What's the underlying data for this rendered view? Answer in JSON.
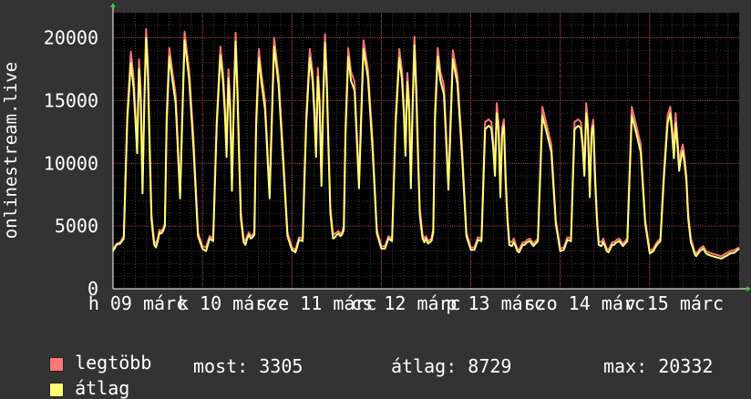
{
  "chart_data": {
    "type": "line",
    "ylabel": "onlinestream.live",
    "ylim": [
      0,
      22000
    ],
    "yticks": [
      "0",
      "5000",
      "10000",
      "15000",
      "20000"
    ],
    "xlim": [
      0,
      7
    ],
    "xtick_labels": [
      "h 09 márc",
      "k 10 márc",
      "sze 11 márc",
      "cs 12 márc",
      "p 13 márc",
      "szo 14 márc",
      "v 15 márc"
    ],
    "xticks": [
      0,
      1,
      2,
      3,
      4,
      5,
      6
    ],
    "grid": true,
    "background": "#000000",
    "series": [
      {
        "name": "legtöbb",
        "color": "#ff7777",
        "x": [
          0.0,
          0.04,
          0.08,
          0.12,
          0.16,
          0.2,
          0.23,
          0.25,
          0.27,
          0.29,
          0.31,
          0.33,
          0.35,
          0.37,
          0.39,
          0.41,
          0.43,
          0.46,
          0.48,
          0.5,
          0.52,
          0.54,
          0.56,
          0.58,
          0.6,
          0.63,
          0.66,
          0.7,
          0.75,
          0.8,
          0.85,
          0.9,
          0.95,
          1.0,
          1.04,
          1.08,
          1.12,
          1.16,
          1.2,
          1.23,
          1.25,
          1.27,
          1.29,
          1.31,
          1.33,
          1.35,
          1.37,
          1.39,
          1.41,
          1.43,
          1.46,
          1.48,
          1.5,
          1.52,
          1.54,
          1.56,
          1.58,
          1.6,
          1.63,
          1.66,
          1.7,
          1.75,
          1.8,
          1.85,
          1.9,
          1.95,
          2.0,
          2.04,
          2.08,
          2.12,
          2.16,
          2.2,
          2.23,
          2.25,
          2.27,
          2.29,
          2.31,
          2.33,
          2.35,
          2.37,
          2.39,
          2.41,
          2.43,
          2.46,
          2.48,
          2.5,
          2.52,
          2.54,
          2.56,
          2.58,
          2.6,
          2.63,
          2.66,
          2.7,
          2.75,
          2.8,
          2.85,
          2.9,
          2.95,
          3.0,
          3.04,
          3.08,
          3.12,
          3.16,
          3.2,
          3.23,
          3.25,
          3.27,
          3.29,
          3.31,
          3.33,
          3.35,
          3.37,
          3.39,
          3.41,
          3.43,
          3.46,
          3.48,
          3.5,
          3.52,
          3.54,
          3.56,
          3.58,
          3.6,
          3.63,
          3.66,
          3.7,
          3.75,
          3.8,
          3.85,
          3.9,
          3.95,
          4.0,
          4.04,
          4.08,
          4.12,
          4.16,
          4.2,
          4.23,
          4.25,
          4.27,
          4.29,
          4.31,
          4.33,
          4.35,
          4.37,
          4.39,
          4.41,
          4.43,
          4.46,
          4.48,
          4.5,
          4.52,
          4.54,
          4.56,
          4.58,
          4.6,
          4.63,
          4.66,
          4.7,
          4.75,
          4.8,
          4.85,
          4.9,
          4.95,
          5.0,
          5.04,
          5.08,
          5.12,
          5.16,
          5.2,
          5.23,
          5.25,
          5.27,
          5.29,
          5.31,
          5.33,
          5.35,
          5.37,
          5.39,
          5.41,
          5.43,
          5.46,
          5.48,
          5.5,
          5.52,
          5.54,
          5.56,
          5.58,
          5.6,
          5.63,
          5.66,
          5.7,
          5.75,
          5.8,
          5.85,
          5.9,
          5.95,
          6.0,
          6.04,
          6.08,
          6.12,
          6.16,
          6.2,
          6.23,
          6.25,
          6.27,
          6.29,
          6.31,
          6.33,
          6.35,
          6.37,
          6.39,
          6.41,
          6.43,
          6.46,
          6.48,
          6.5,
          6.52,
          6.54,
          6.56,
          6.58,
          6.6,
          6.63,
          6.66,
          6.7,
          6.75,
          6.8,
          6.85,
          6.9,
          6.95,
          7.0
        ],
        "values": [
          3100,
          3600,
          3700,
          4200,
          14000,
          18900,
          16800,
          14200,
          11400,
          18300,
          16000,
          8200,
          15000,
          20700,
          18000,
          12000,
          6000,
          3800,
          3600,
          4000,
          4700,
          4600,
          4800,
          5200,
          14000,
          19200,
          17500,
          15500,
          7800,
          20500,
          17500,
          12000,
          4500,
          3400,
          3300,
          4200,
          4000,
          13500,
          19300,
          17200,
          14700,
          11200,
          17500,
          14800,
          8400,
          15200,
          20400,
          16500,
          11000,
          6100,
          4000,
          3800,
          4200,
          4500,
          4200,
          4300,
          4500,
          13500,
          19100,
          17100,
          15000,
          7700,
          20000,
          17000,
          11000,
          4500,
          3300,
          3100,
          4100,
          4000,
          13800,
          19100,
          17300,
          14800,
          11200,
          17600,
          15200,
          8800,
          15500,
          20300,
          16800,
          11500,
          6500,
          4300,
          4400,
          4500,
          4600,
          4400,
          4500,
          5000,
          13200,
          19200,
          17300,
          16500,
          8600,
          19800,
          17500,
          12000,
          4700,
          3400,
          3400,
          4200,
          4000,
          13700,
          19100,
          17400,
          14800,
          11300,
          17200,
          14900,
          8600,
          15200,
          20100,
          16300,
          11000,
          6400,
          4300,
          4000,
          4200,
          3800,
          3900,
          4000,
          4800,
          14200,
          19200,
          17300,
          16200,
          8400,
          19000,
          17000,
          11500,
          4500,
          3300,
          3300,
          4100,
          4000,
          13300,
          13500,
          13300,
          11800,
          9500,
          14800,
          13200,
          7800,
          12800,
          13500,
          9000,
          5800,
          3800,
          3700,
          4000,
          3600,
          3200,
          3100,
          3400,
          3700,
          3700,
          3900,
          4000,
          3600,
          4000,
          14500,
          13000,
          11500,
          5500,
          3200,
          3300,
          4100,
          4000,
          13300,
          13500,
          13300,
          11800,
          9500,
          14800,
          13200,
          7800,
          12800,
          13500,
          9000,
          5800,
          3800,
          3700,
          4000,
          3600,
          3200,
          3100,
          3400,
          3700,
          3700,
          3900,
          4000,
          3600,
          4000,
          14500,
          13000,
          11500,
          5500,
          3000,
          3200,
          3700,
          4000,
          9500,
          13800,
          14500,
          13000,
          11000,
          14000,
          12000,
          10000,
          11000,
          11500,
          10500,
          9000,
          6000,
          4000,
          3500,
          3000,
          2800,
          3000,
          3200,
          3300,
          3400,
          3000,
          2900,
          2800,
          2700,
          2600,
          2800,
          3000,
          3100,
          3305
        ]
      },
      {
        "name": "átlag",
        "color": "#ffff77",
        "x": [
          0.0,
          0.04,
          0.08,
          0.12,
          0.16,
          0.2,
          0.23,
          0.25,
          0.27,
          0.29,
          0.31,
          0.33,
          0.35,
          0.37,
          0.39,
          0.41,
          0.43,
          0.46,
          0.48,
          0.5,
          0.52,
          0.54,
          0.56,
          0.58,
          0.6,
          0.63,
          0.66,
          0.7,
          0.75,
          0.8,
          0.85,
          0.9,
          0.95,
          1.0,
          1.04,
          1.08,
          1.12,
          1.16,
          1.2,
          1.23,
          1.25,
          1.27,
          1.29,
          1.31,
          1.33,
          1.35,
          1.37,
          1.39,
          1.41,
          1.43,
          1.46,
          1.48,
          1.5,
          1.52,
          1.54,
          1.56,
          1.58,
          1.6,
          1.63,
          1.66,
          1.7,
          1.75,
          1.8,
          1.85,
          1.9,
          1.95,
          2.0,
          2.04,
          2.08,
          2.12,
          2.16,
          2.2,
          2.23,
          2.25,
          2.27,
          2.29,
          2.31,
          2.33,
          2.35,
          2.37,
          2.39,
          2.41,
          2.43,
          2.46,
          2.48,
          2.5,
          2.52,
          2.54,
          2.56,
          2.58,
          2.6,
          2.63,
          2.66,
          2.7,
          2.75,
          2.8,
          2.85,
          2.9,
          2.95,
          3.0,
          3.04,
          3.08,
          3.12,
          3.16,
          3.2,
          3.23,
          3.25,
          3.27,
          3.29,
          3.31,
          3.33,
          3.35,
          3.37,
          3.39,
          3.41,
          3.43,
          3.46,
          3.48,
          3.5,
          3.52,
          3.54,
          3.56,
          3.58,
          3.6,
          3.63,
          3.66,
          3.7,
          3.75,
          3.8,
          3.85,
          3.9,
          3.95,
          4.0,
          4.04,
          4.08,
          4.12,
          4.16,
          4.2,
          4.23,
          4.25,
          4.27,
          4.29,
          4.31,
          4.33,
          4.35,
          4.37,
          4.39,
          4.41,
          4.43,
          4.46,
          4.48,
          4.5,
          4.52,
          4.54,
          4.56,
          4.58,
          4.6,
          4.63,
          4.66,
          4.7,
          4.75,
          4.8,
          4.85,
          4.9,
          4.95,
          5.0,
          5.04,
          5.08,
          5.12,
          5.16,
          5.2,
          5.23,
          5.25,
          5.27,
          5.29,
          5.31,
          5.33,
          5.35,
          5.37,
          5.39,
          5.41,
          5.43,
          5.46,
          5.48,
          5.5,
          5.52,
          5.54,
          5.56,
          5.58,
          5.6,
          5.63,
          5.66,
          5.7,
          5.75,
          5.8,
          5.85,
          5.9,
          5.95,
          6.0,
          6.04,
          6.08,
          6.12,
          6.16,
          6.2,
          6.23,
          6.25,
          6.27,
          6.29,
          6.31,
          6.33,
          6.35,
          6.37,
          6.39,
          6.41,
          6.43,
          6.46,
          6.48,
          6.5,
          6.52,
          6.54,
          6.56,
          6.58,
          6.6,
          6.63,
          6.66,
          6.7,
          6.75,
          6.8,
          6.85,
          6.9,
          6.95,
          7.0
        ],
        "values": [
          3000,
          3500,
          3600,
          4000,
          13500,
          18000,
          16000,
          13500,
          10800,
          17500,
          15000,
          7600,
          14500,
          20000,
          17000,
          11000,
          5500,
          3500,
          3300,
          3800,
          4500,
          4400,
          4600,
          5000,
          13300,
          18500,
          16800,
          14800,
          7200,
          19800,
          16800,
          11200,
          4200,
          3200,
          3000,
          4000,
          3800,
          13000,
          18600,
          16500,
          14000,
          10500,
          16800,
          14000,
          7800,
          14500,
          19700,
          15800,
          10200,
          5600,
          3700,
          3500,
          4000,
          4300,
          4000,
          4100,
          4300,
          12800,
          18400,
          16400,
          14300,
          7200,
          19300,
          16300,
          10300,
          4200,
          3100,
          2900,
          3900,
          3800,
          13200,
          18400,
          16600,
          14100,
          10500,
          16900,
          14500,
          8200,
          14800,
          19600,
          16100,
          10800,
          6000,
          4000,
          4100,
          4300,
          4400,
          4200,
          4300,
          4700,
          12600,
          18500,
          16600,
          15800,
          8000,
          19100,
          16800,
          11300,
          4400,
          3200,
          3200,
          4000,
          3800,
          13100,
          18400,
          16700,
          14100,
          10600,
          16500,
          14200,
          8000,
          14500,
          19400,
          15600,
          10300,
          5900,
          4000,
          3700,
          4000,
          3600,
          3700,
          3800,
          4500,
          13600,
          18500,
          16600,
          15500,
          7900,
          18300,
          16300,
          10800,
          4200,
          3100,
          3100,
          3900,
          3800,
          12700,
          13000,
          12800,
          11300,
          9000,
          14000,
          12600,
          7300,
          12300,
          13000,
          8500,
          5400,
          3500,
          3400,
          3700,
          3400,
          3000,
          2900,
          3200,
          3500,
          3500,
          3700,
          3800,
          3400,
          3800,
          13800,
          12400,
          10900,
          5200,
          3000,
          3100,
          3900,
          3800,
          12700,
          13000,
          12800,
          11300,
          9000,
          14000,
          12600,
          7300,
          12300,
          13000,
          8500,
          5400,
          3500,
          3400,
          3700,
          3400,
          3000,
          2900,
          3200,
          3500,
          3500,
          3700,
          3800,
          3400,
          3800,
          13800,
          12400,
          10900,
          5200,
          2800,
          3000,
          3500,
          3800,
          9000,
          13200,
          14000,
          12400,
          10400,
          13200,
          11400,
          9400,
          10400,
          11000,
          10000,
          8600,
          5600,
          3700,
          3300,
          2800,
          2600,
          2800,
          3000,
          3100,
          3200,
          2800,
          2700,
          2600,
          2500,
          2400,
          2600,
          2800,
          2900,
          3200
        ]
      }
    ]
  },
  "legend": [
    {
      "label": "legtöbb",
      "color": "#ff7777"
    },
    {
      "label": "átlag",
      "color": "#ffff77"
    }
  ],
  "stats": {
    "now": "most: 3305",
    "avg": "átlag: 8729",
    "max": "max: 20332"
  }
}
